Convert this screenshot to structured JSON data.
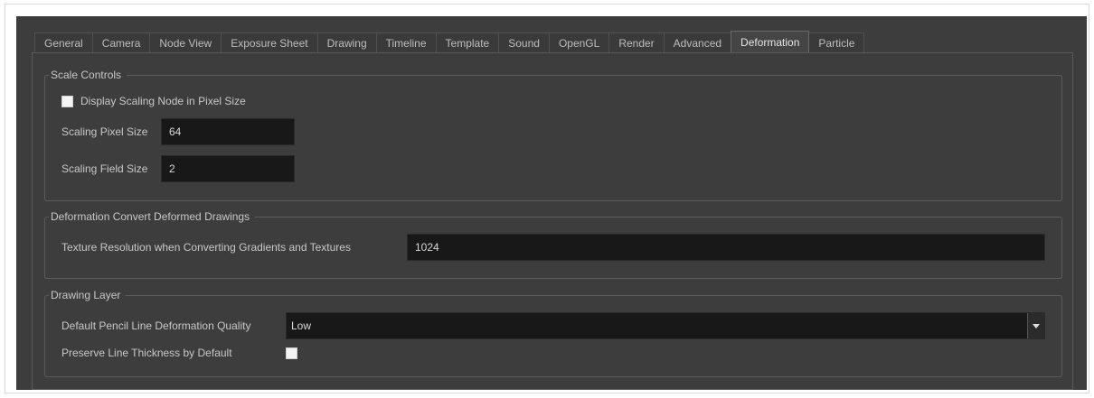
{
  "tabs": [
    {
      "label": "General"
    },
    {
      "label": "Camera"
    },
    {
      "label": "Node View"
    },
    {
      "label": "Exposure Sheet"
    },
    {
      "label": "Drawing"
    },
    {
      "label": "Timeline"
    },
    {
      "label": "Template"
    },
    {
      "label": "Sound"
    },
    {
      "label": "OpenGL"
    },
    {
      "label": "Render"
    },
    {
      "label": "Advanced"
    },
    {
      "label": "Deformation",
      "active": true
    },
    {
      "label": "Particle"
    }
  ],
  "scale_controls": {
    "title": "Scale Controls",
    "display_scaling_label": "Display Scaling Node in Pixel Size",
    "display_scaling_checked": false,
    "pixel_size_label": "Scaling Pixel Size",
    "pixel_size_value": "64",
    "field_size_label": "Scaling Field Size",
    "field_size_value": "2"
  },
  "deformation_convert": {
    "title": "Deformation Convert Deformed Drawings",
    "texture_label": "Texture Resolution when Converting Gradients and Textures",
    "texture_value": "1024"
  },
  "drawing_layer": {
    "title": "Drawing Layer",
    "pencil_quality_label": "Default Pencil Line Deformation Quality",
    "pencil_quality_value": "Low",
    "preserve_thickness_label": "Preserve Line Thickness by Default",
    "preserve_thickness_checked": false
  },
  "icons": {
    "dropdown": "chevron-down-icon"
  },
  "colors": {
    "background": "#3d3d3d",
    "field_background": "#181818",
    "text": "#c8c8c8"
  }
}
